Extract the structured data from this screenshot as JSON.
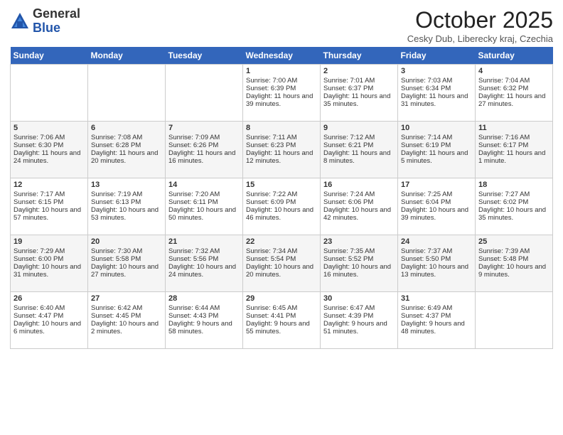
{
  "header": {
    "logo_general": "General",
    "logo_blue": "Blue",
    "month_title": "October 2025",
    "location": "Cesky Dub, Liberecky kraj, Czechia"
  },
  "days_of_week": [
    "Sunday",
    "Monday",
    "Tuesday",
    "Wednesday",
    "Thursday",
    "Friday",
    "Saturday"
  ],
  "weeks": [
    {
      "cells": [
        {
          "empty": true
        },
        {
          "empty": true
        },
        {
          "empty": true
        },
        {
          "day": 1,
          "sunrise": "7:00 AM",
          "sunset": "6:39 PM",
          "daylight": "11 hours and 39 minutes."
        },
        {
          "day": 2,
          "sunrise": "7:01 AM",
          "sunset": "6:37 PM",
          "daylight": "11 hours and 35 minutes."
        },
        {
          "day": 3,
          "sunrise": "7:03 AM",
          "sunset": "6:34 PM",
          "daylight": "11 hours and 31 minutes."
        },
        {
          "day": 4,
          "sunrise": "7:04 AM",
          "sunset": "6:32 PM",
          "daylight": "11 hours and 27 minutes."
        }
      ]
    },
    {
      "cells": [
        {
          "day": 5,
          "sunrise": "7:06 AM",
          "sunset": "6:30 PM",
          "daylight": "11 hours and 24 minutes."
        },
        {
          "day": 6,
          "sunrise": "7:08 AM",
          "sunset": "6:28 PM",
          "daylight": "11 hours and 20 minutes."
        },
        {
          "day": 7,
          "sunrise": "7:09 AM",
          "sunset": "6:26 PM",
          "daylight": "11 hours and 16 minutes."
        },
        {
          "day": 8,
          "sunrise": "7:11 AM",
          "sunset": "6:23 PM",
          "daylight": "11 hours and 12 minutes."
        },
        {
          "day": 9,
          "sunrise": "7:12 AM",
          "sunset": "6:21 PM",
          "daylight": "11 hours and 8 minutes."
        },
        {
          "day": 10,
          "sunrise": "7:14 AM",
          "sunset": "6:19 PM",
          "daylight": "11 hours and 5 minutes."
        },
        {
          "day": 11,
          "sunrise": "7:16 AM",
          "sunset": "6:17 PM",
          "daylight": "11 hours and 1 minute."
        }
      ]
    },
    {
      "cells": [
        {
          "day": 12,
          "sunrise": "7:17 AM",
          "sunset": "6:15 PM",
          "daylight": "10 hours and 57 minutes."
        },
        {
          "day": 13,
          "sunrise": "7:19 AM",
          "sunset": "6:13 PM",
          "daylight": "10 hours and 53 minutes."
        },
        {
          "day": 14,
          "sunrise": "7:20 AM",
          "sunset": "6:11 PM",
          "daylight": "10 hours and 50 minutes."
        },
        {
          "day": 15,
          "sunrise": "7:22 AM",
          "sunset": "6:09 PM",
          "daylight": "10 hours and 46 minutes."
        },
        {
          "day": 16,
          "sunrise": "7:24 AM",
          "sunset": "6:06 PM",
          "daylight": "10 hours and 42 minutes."
        },
        {
          "day": 17,
          "sunrise": "7:25 AM",
          "sunset": "6:04 PM",
          "daylight": "10 hours and 39 minutes."
        },
        {
          "day": 18,
          "sunrise": "7:27 AM",
          "sunset": "6:02 PM",
          "daylight": "10 hours and 35 minutes."
        }
      ]
    },
    {
      "cells": [
        {
          "day": 19,
          "sunrise": "7:29 AM",
          "sunset": "6:00 PM",
          "daylight": "10 hours and 31 minutes."
        },
        {
          "day": 20,
          "sunrise": "7:30 AM",
          "sunset": "5:58 PM",
          "daylight": "10 hours and 27 minutes."
        },
        {
          "day": 21,
          "sunrise": "7:32 AM",
          "sunset": "5:56 PM",
          "daylight": "10 hours and 24 minutes."
        },
        {
          "day": 22,
          "sunrise": "7:34 AM",
          "sunset": "5:54 PM",
          "daylight": "10 hours and 20 minutes."
        },
        {
          "day": 23,
          "sunrise": "7:35 AM",
          "sunset": "5:52 PM",
          "daylight": "10 hours and 16 minutes."
        },
        {
          "day": 24,
          "sunrise": "7:37 AM",
          "sunset": "5:50 PM",
          "daylight": "10 hours and 13 minutes."
        },
        {
          "day": 25,
          "sunrise": "7:39 AM",
          "sunset": "5:48 PM",
          "daylight": "10 hours and 9 minutes."
        }
      ]
    },
    {
      "cells": [
        {
          "day": 26,
          "sunrise": "6:40 AM",
          "sunset": "4:47 PM",
          "daylight": "10 hours and 6 minutes."
        },
        {
          "day": 27,
          "sunrise": "6:42 AM",
          "sunset": "4:45 PM",
          "daylight": "10 hours and 2 minutes."
        },
        {
          "day": 28,
          "sunrise": "6:44 AM",
          "sunset": "4:43 PM",
          "daylight": "9 hours and 58 minutes."
        },
        {
          "day": 29,
          "sunrise": "6:45 AM",
          "sunset": "4:41 PM",
          "daylight": "9 hours and 55 minutes."
        },
        {
          "day": 30,
          "sunrise": "6:47 AM",
          "sunset": "4:39 PM",
          "daylight": "9 hours and 51 minutes."
        },
        {
          "day": 31,
          "sunrise": "6:49 AM",
          "sunset": "4:37 PM",
          "daylight": "9 hours and 48 minutes."
        },
        {
          "empty": true
        }
      ]
    }
  ]
}
